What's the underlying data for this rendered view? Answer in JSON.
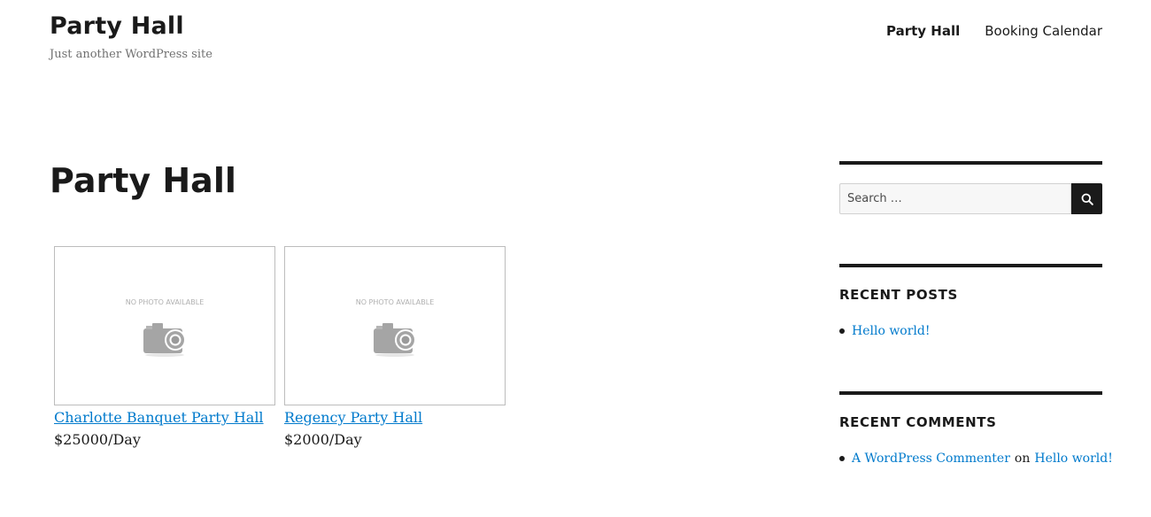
{
  "site": {
    "title": "Party Hall",
    "description": "Just another WordPress site"
  },
  "nav": {
    "items": [
      {
        "label": "Party Hall",
        "current": true
      },
      {
        "label": "Booking Calendar",
        "current": false
      }
    ]
  },
  "page": {
    "title": "Party Hall"
  },
  "halls": [
    {
      "name": "Charlotte Banquet Party Hall",
      "price": "$25000/Day",
      "photo_text": "NO PHOTO AVAILABLE",
      "photo_icon": "camera-icon"
    },
    {
      "name": "Regency Party Hall",
      "price": "$2000/Day",
      "photo_text": "NO PHOTO AVAILABLE",
      "photo_icon": "camera-icon"
    }
  ],
  "sidebar": {
    "search": {
      "placeholder": "Search …",
      "button_icon": "search-icon"
    },
    "recent_posts": {
      "title": "RECENT POSTS",
      "items": [
        "Hello world!"
      ]
    },
    "recent_comments": {
      "title": "RECENT COMMENTS",
      "items": [
        {
          "author": "A WordPress Commenter",
          "connector": "on",
          "post": "Hello world!"
        }
      ]
    }
  },
  "colors": {
    "link": "#007acc",
    "text": "#1a1a1a",
    "muted": "#707070",
    "search_button": "#1a1a1a"
  }
}
